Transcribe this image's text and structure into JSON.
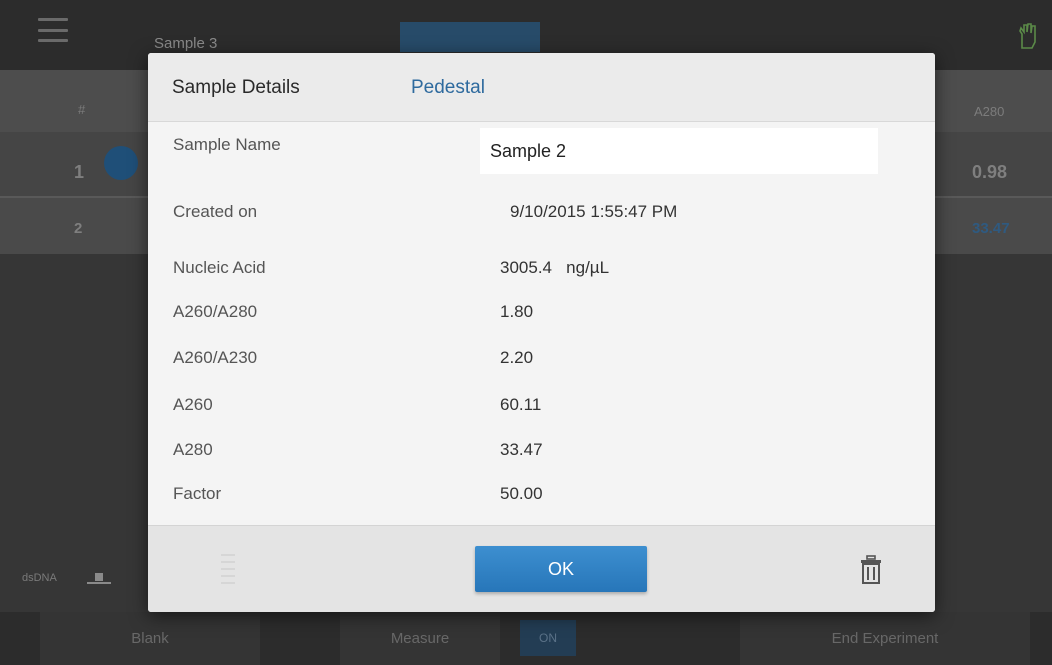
{
  "background": {
    "window_title": "Sample 3",
    "table_header": {
      "index": "#",
      "a280": "A280"
    },
    "rows": [
      {
        "index": "1",
        "a280": "0.98"
      },
      {
        "index": "2",
        "a280": "33.47"
      }
    ],
    "sample_type": "dsDNA",
    "bottom_buttons": {
      "blank": "Blank",
      "measure": "Measure",
      "toggle": "ON",
      "end": "End Experiment"
    }
  },
  "dialog": {
    "title": "Sample Details",
    "tab": "Pedestal",
    "sample_name_label": "Sample Name",
    "sample_name_value": "Sample 2",
    "created_label": "Created on",
    "created_value": "9/10/2015 1:55:47 PM",
    "fields": [
      {
        "label": "Nucleic Acid",
        "value": "3005.4   ng/µL"
      },
      {
        "label": "A260/A280",
        "value": "1.80"
      },
      {
        "label": "A260/A230",
        "value": "2.20"
      },
      {
        "label": "A260",
        "value": "60.11"
      },
      {
        "label": "A280",
        "value": "33.47"
      },
      {
        "label": "Factor",
        "value": "50.00"
      }
    ],
    "ok_label": "OK",
    "icons": {
      "list": "list-icon",
      "trash": "trash-icon"
    }
  },
  "colors": {
    "accent": "#2e6a9e",
    "ok_button": "#2f80c3"
  }
}
